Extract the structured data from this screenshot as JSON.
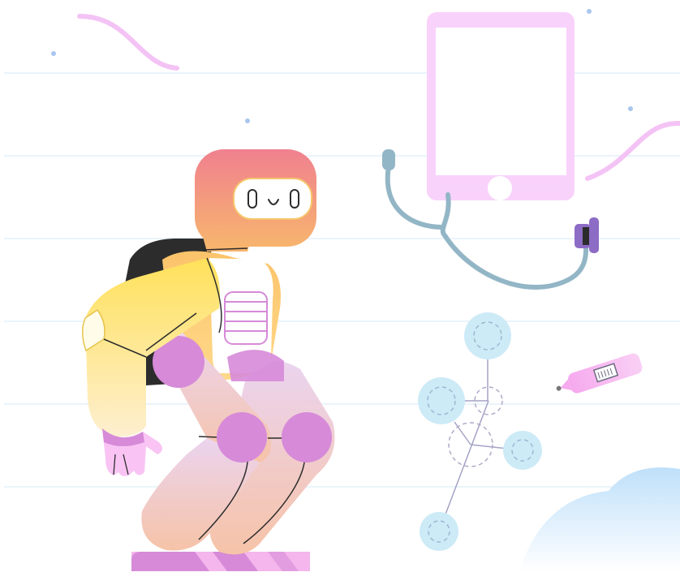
{
  "scene": {
    "subjects": [
      "robot",
      "tablet",
      "stethoscope",
      "thermometer",
      "molecule"
    ],
    "colors": {
      "line": "#eaf4fb",
      "dot": "#9fbff0",
      "squiggle": "#f4c3f5",
      "tablet": "#f9d2fb",
      "stethoscope": "#93b6c6",
      "stethoscope_head": "#8c6cc4",
      "molecule_node": "#cdeaf7",
      "thermometer": "#f7c6f2",
      "robot_head_top": "#f0808f",
      "robot_head_bottom": "#f7b46e",
      "robot_body_top": "#ffe060",
      "robot_body_bottom": "#fbeccd",
      "robot_joint": "#d68ad8",
      "robot_leg_top": "#ecd3ee",
      "robot_leg_bottom": "#f7c4a9",
      "robot_dark": "#2c2c2c",
      "blob": "#c4e2fa"
    },
    "robot_face": {
      "eyes": "0 0",
      "mouth": "smile"
    }
  }
}
